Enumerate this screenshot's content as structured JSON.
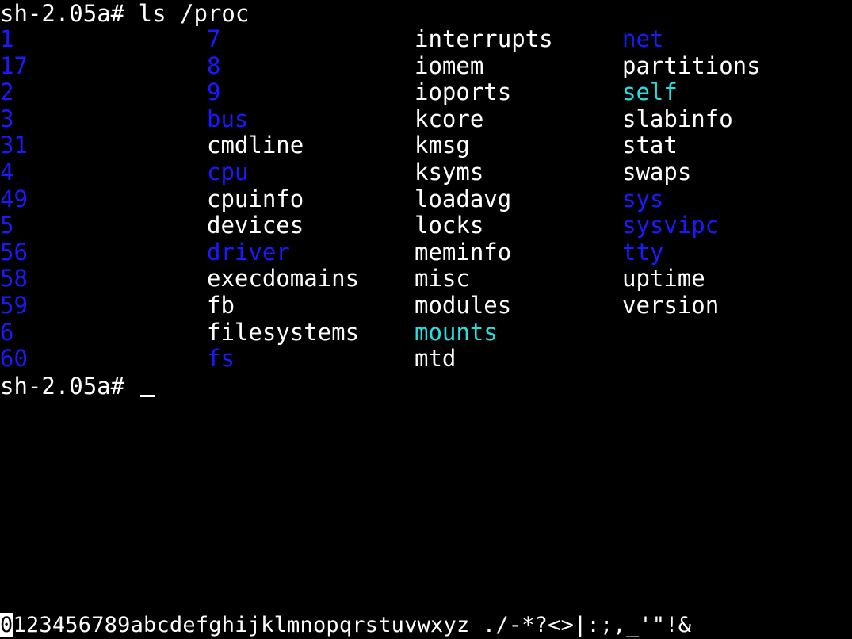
{
  "terminal": {
    "prompt": "sh-2.05a#",
    "command": "ls /proc",
    "colors": {
      "background": "#000000",
      "file": "#ffffff",
      "directory": "#1a1aff",
      "symlink": "#22e0e0"
    },
    "columns": [
      {
        "entries": [
          {
            "name": "1",
            "type": "dir"
          },
          {
            "name": "17",
            "type": "dir"
          },
          {
            "name": "2",
            "type": "dir"
          },
          {
            "name": "3",
            "type": "dir"
          },
          {
            "name": "31",
            "type": "dir"
          },
          {
            "name": "4",
            "type": "dir"
          },
          {
            "name": "49",
            "type": "dir"
          },
          {
            "name": "5",
            "type": "dir"
          },
          {
            "name": "56",
            "type": "dir"
          },
          {
            "name": "58",
            "type": "dir"
          },
          {
            "name": "59",
            "type": "dir"
          },
          {
            "name": "6",
            "type": "dir"
          },
          {
            "name": "60",
            "type": "dir"
          }
        ]
      },
      {
        "entries": [
          {
            "name": "7",
            "type": "dir"
          },
          {
            "name": "8",
            "type": "dir"
          },
          {
            "name": "9",
            "type": "dir"
          },
          {
            "name": "bus",
            "type": "dir"
          },
          {
            "name": "cmdline",
            "type": "file"
          },
          {
            "name": "cpu",
            "type": "dir"
          },
          {
            "name": "cpuinfo",
            "type": "file"
          },
          {
            "name": "devices",
            "type": "file"
          },
          {
            "name": "driver",
            "type": "dir"
          },
          {
            "name": "execdomains",
            "type": "file"
          },
          {
            "name": "fb",
            "type": "file"
          },
          {
            "name": "filesystems",
            "type": "file"
          },
          {
            "name": "fs",
            "type": "dir"
          }
        ]
      },
      {
        "entries": [
          {
            "name": "interrupts",
            "type": "file"
          },
          {
            "name": "iomem",
            "type": "file"
          },
          {
            "name": "ioports",
            "type": "file"
          },
          {
            "name": "kcore",
            "type": "file"
          },
          {
            "name": "kmsg",
            "type": "file"
          },
          {
            "name": "ksyms",
            "type": "file"
          },
          {
            "name": "loadavg",
            "type": "file"
          },
          {
            "name": "locks",
            "type": "file"
          },
          {
            "name": "meminfo",
            "type": "file"
          },
          {
            "name": "misc",
            "type": "file"
          },
          {
            "name": "modules",
            "type": "file"
          },
          {
            "name": "mounts",
            "type": "link"
          },
          {
            "name": "mtd",
            "type": "file"
          }
        ]
      },
      {
        "entries": [
          {
            "name": "net",
            "type": "dir"
          },
          {
            "name": "partitions",
            "type": "file"
          },
          {
            "name": "self",
            "type": "link"
          },
          {
            "name": "slabinfo",
            "type": "file"
          },
          {
            "name": "stat",
            "type": "file"
          },
          {
            "name": "swaps",
            "type": "file"
          },
          {
            "name": "sys",
            "type": "dir"
          },
          {
            "name": "sysvipc",
            "type": "dir"
          },
          {
            "name": "tty",
            "type": "dir"
          },
          {
            "name": "uptime",
            "type": "file"
          },
          {
            "name": "version",
            "type": "file"
          }
        ]
      }
    ]
  },
  "char_selector": {
    "selected": "0",
    "rest": "123456789abcdefghijklmnopqrstuvwxyz ./-*?<>|:;,_'\"!&"
  }
}
